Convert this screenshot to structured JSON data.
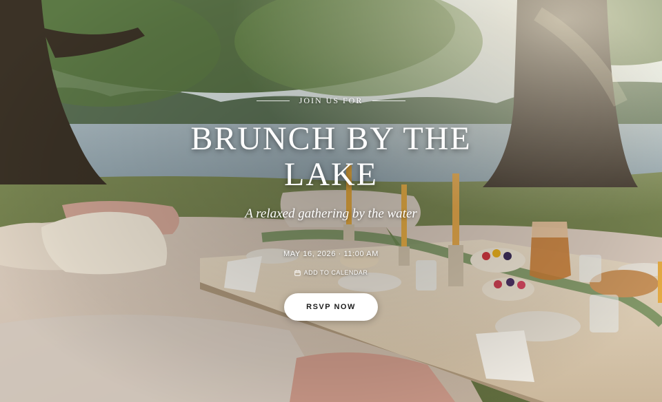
{
  "hero": {
    "eyebrow": "JOIN US FOR",
    "title": "BRUNCH BY THE LAKE",
    "tagline": "A relaxed gathering by the water",
    "datetime": "MAY 16, 2026 · 11:00 AM",
    "calendar_link": "ADD TO CALENDAR",
    "calendar_icon": "calendar-icon",
    "rsvp_label": "RSVP NOW"
  },
  "colors": {
    "button_background": "#ffffff",
    "button_text": "#1c1c1c",
    "text": "#ffffff"
  }
}
